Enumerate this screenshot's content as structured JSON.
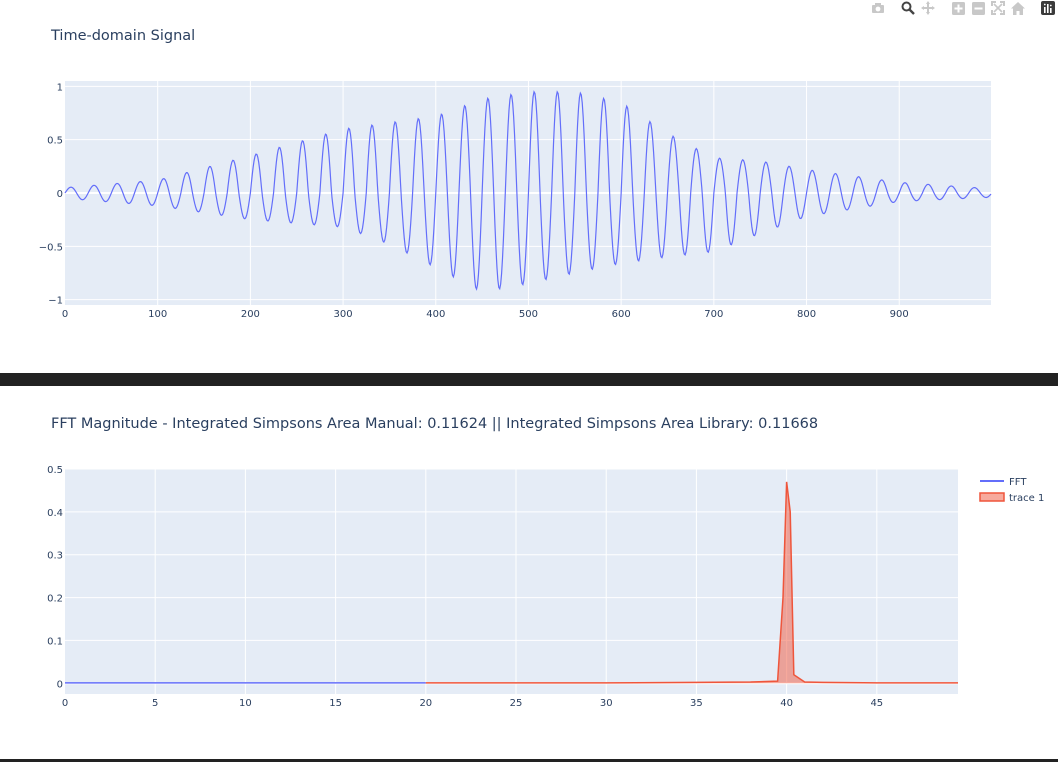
{
  "toolbar": {
    "icons": [
      "camera-icon",
      "zoom-icon",
      "pan-icon",
      "zoom-in-icon",
      "zoom-out-icon",
      "autoscale-icon",
      "home-icon",
      "plotly-logo-icon"
    ]
  },
  "colors": {
    "blue": "#636efa",
    "red": "#ef553b",
    "plot_bg": "#e5ecf6",
    "grid": "#ffffff",
    "text": "#2a3f5f",
    "divider": "#222222"
  },
  "chart_data": [
    {
      "type": "line",
      "title": "Time-domain Signal",
      "xlabel": "",
      "ylabel": "",
      "xlim": [
        0,
        999
      ],
      "ylim": [
        -1.05,
        1.05
      ],
      "x_ticks": [
        "0",
        "100",
        "200",
        "300",
        "400",
        "500",
        "600",
        "700",
        "800",
        "900"
      ],
      "y_ticks": [
        "−1",
        "−0.5",
        "0",
        "0.5",
        "1"
      ],
      "grid": true,
      "series": [
        {
          "signal": "sine carrier, frequency 40 per 1000 samples, modulated by envelope",
          "envelope_x": [
            0,
            100,
            200,
            300,
            350,
            400,
            450,
            500,
            550,
            600,
            650,
            700,
            750,
            800,
            900,
            999
          ],
          "envelope_upper": [
            0.05,
            0.12,
            0.35,
            0.6,
            0.66,
            0.72,
            0.88,
            0.95,
            0.95,
            0.85,
            0.56,
            0.33,
            0.3,
            0.22,
            0.1,
            0.04
          ],
          "envelope_lower": [
            -0.05,
            -0.12,
            -0.25,
            -0.32,
            -0.48,
            -0.7,
            -0.93,
            -0.85,
            -0.75,
            -0.66,
            -0.6,
            -0.55,
            -0.38,
            -0.22,
            -0.08,
            -0.04
          ]
        }
      ]
    },
    {
      "type": "line",
      "title": "FFT Magnitude - Integrated Simpsons Area Manual: 0.11624 || Integrated Simpsons Area Library: 0.11668",
      "xlabel": "",
      "ylabel": "",
      "xlim": [
        0,
        49.5
      ],
      "ylim": [
        -0.025,
        0.5
      ],
      "x_ticks": [
        "0",
        "5",
        "10",
        "15",
        "20",
        "25",
        "30",
        "35",
        "40",
        "45"
      ],
      "y_ticks": [
        "0",
        "0.1",
        "0.2",
        "0.3",
        "0.4",
        "0.5"
      ],
      "grid": true,
      "legend_position": "top-right",
      "series": [
        {
          "name": "FFT",
          "x": [
            0,
            5,
            10,
            15,
            20
          ],
          "y": [
            0.001,
            0.001,
            0.001,
            0.001,
            0.001
          ]
        },
        {
          "name": "trace 1",
          "fill": "tozeroy",
          "x": [
            20,
            25,
            30,
            35,
            38,
            39.5,
            39.8,
            40,
            40.2,
            40.4,
            41,
            42,
            45,
            49.5
          ],
          "y": [
            0.001,
            0.001,
            0.001,
            0.002,
            0.003,
            0.005,
            0.2,
            0.47,
            0.4,
            0.02,
            0.003,
            0.002,
            0.001,
            0.001
          ]
        }
      ]
    }
  ]
}
